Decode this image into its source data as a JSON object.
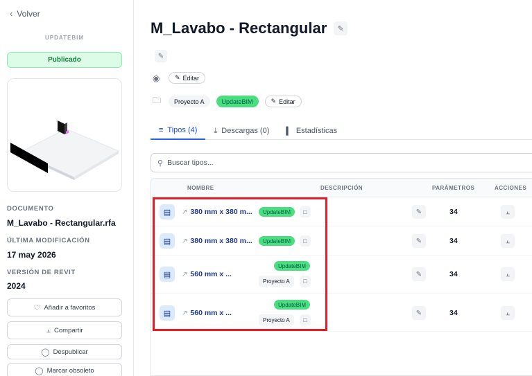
{
  "sidebar": {
    "back_label": "Volver",
    "brand": "UPDATEBIM",
    "status": "Publicado",
    "document_label": "DOCUMENTO",
    "document_value": "M_Lavabo - Rectangular.rfa",
    "modified_label": "ÚLTIMA MODIFICACIÓN",
    "modified_value": "17 may 2026",
    "revit_label": "VERSIÓN DE REVIT",
    "revit_value": "2024",
    "buttons": [
      {
        "label": "Añadir a favoritos",
        "icon": "heart-icon"
      },
      {
        "label": "Compartir",
        "icon": "share-icon"
      },
      {
        "label": "Despublicar",
        "icon": "shield-icon"
      },
      {
        "label": "Marcar obsoleto",
        "icon": "shield-icon"
      }
    ]
  },
  "header": {
    "title": "M_Lavabo - Rectangular",
    "tags_edit": "Editar",
    "folders": [
      "Proyecto A",
      "UpdateBIM"
    ],
    "folders_edit": "Editar"
  },
  "tabs": [
    {
      "label": "Tipos (4)",
      "icon": "layers-icon",
      "active": true
    },
    {
      "label": "Descargas (0)",
      "icon": "download-icon",
      "active": false
    },
    {
      "label": "Estadísticas",
      "icon": "bar-chart-icon",
      "active": false
    }
  ],
  "search": {
    "placeholder": "Buscar tipos..."
  },
  "table": {
    "columns": [
      "NOMBRE",
      "DESCRIPCIÓN",
      "PARÁMETROS",
      "ACCIONES"
    ],
    "rows": [
      {
        "name": "380 mm x 380 m...",
        "tags": [
          "UpdateBIM"
        ],
        "params": "34"
      },
      {
        "name": "380 mm x 380 m...",
        "tags": [
          "UpdateBIM"
        ],
        "params": "34"
      },
      {
        "name": "560 mm x ...",
        "tags": [
          "UpdateBIM",
          "Proyecto A"
        ],
        "params": "34"
      },
      {
        "name": "560 mm x ...",
        "tags": [
          "UpdateBIM",
          "Proyecto A"
        ],
        "params": "34"
      }
    ]
  },
  "colors": {
    "accent": "#2563eb",
    "published_bg": "#dcfce7",
    "tag_green": "#4ade80",
    "highlight": "#e11d2a"
  }
}
